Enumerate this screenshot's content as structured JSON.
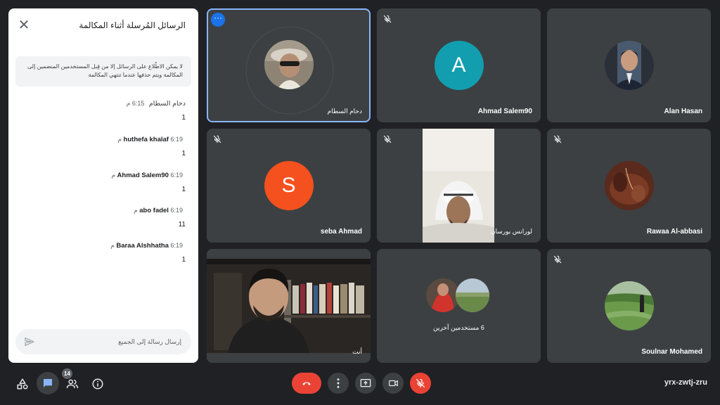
{
  "chat": {
    "title": "الرسائل المُرسلة أثناء المكالمة",
    "notice": "لا يمكن الاطّلاع على الرسائل إلا من قِبل المستخدمين المنضمين إلى المكالمة ويتم حذفها عندما تنتهي المكالمة",
    "messages": [
      {
        "sender": "دحام السطام",
        "time": "6:15 م",
        "text": "1"
      },
      {
        "sender": "huthefa khalaf",
        "time": "6:19 م",
        "text": "1"
      },
      {
        "sender": "Ahmad Salem90",
        "time": "6:19 م",
        "text": "1"
      },
      {
        "sender": "abo fadel",
        "time": "6:19 م",
        "text": "11"
      },
      {
        "sender": "Baraa Alshhatha",
        "time": "6:19 م",
        "text": "1"
      }
    ],
    "input_placeholder": "إرسال رسالة إلى الجميع"
  },
  "tiles": [
    {
      "name": "دحام السطام"
    },
    {
      "name": "Ahmad Salem90",
      "letter": "A"
    },
    {
      "name": "Alan Hasan"
    },
    {
      "name": "seba Ahmad",
      "letter": "S"
    },
    {
      "name": "لورانس بورسان"
    },
    {
      "name": "Rawaa Al-abbasi"
    },
    {
      "name": "أنت"
    },
    {
      "name": "6 مستخدمين آخرين"
    },
    {
      "name": "Soulnar Mohamed"
    }
  ],
  "bottom": {
    "participants_count": "14",
    "meeting_code": "yrx-zwtj-zru"
  },
  "colors": {
    "avatar_teal": "#129eaf",
    "avatar_orange": "#f4511e",
    "end_call_red": "#ea4335",
    "active_outline": "#8ab4f8"
  }
}
